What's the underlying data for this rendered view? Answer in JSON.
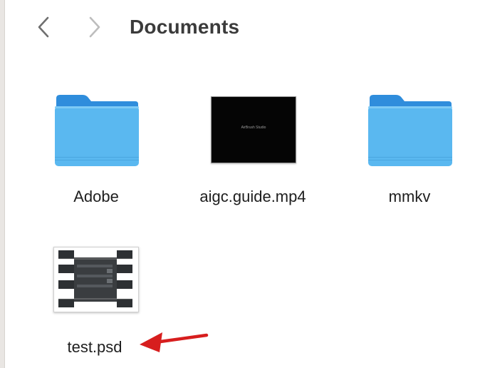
{
  "toolbar": {
    "back_icon": "chevron-left-icon",
    "forward_icon": "chevron-right-icon",
    "title": "Documents"
  },
  "files": [
    {
      "name": "Adobe",
      "kind": "folder",
      "icon": "folder-icon",
      "color": "#5ab8f0"
    },
    {
      "name": "aigc.guide.mp4",
      "kind": "video",
      "icon": "video-thumbnail",
      "thumbnail_text": "AirBrush Studio"
    },
    {
      "name": "mmkv",
      "kind": "folder",
      "icon": "folder-icon",
      "color": "#5ab8f0"
    },
    {
      "name": "test.psd",
      "kind": "image",
      "icon": "psd-thumbnail"
    }
  ],
  "annotation": {
    "arrow_color": "#d71e1e",
    "points_to": "test.psd"
  }
}
